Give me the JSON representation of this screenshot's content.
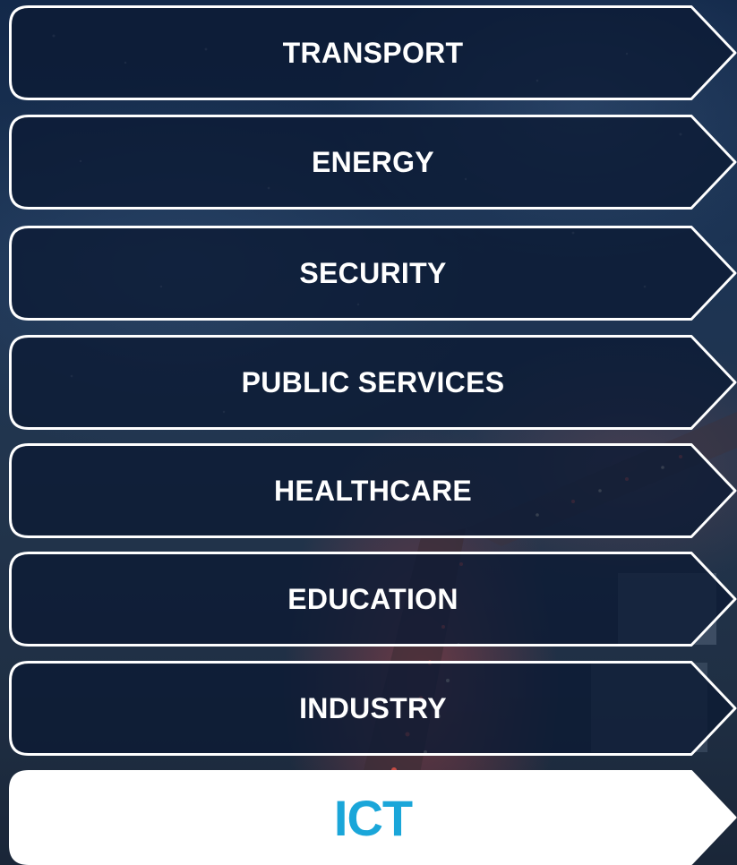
{
  "menu": {
    "items": [
      {
        "label": "TRANSPORT",
        "active": false
      },
      {
        "label": "ENERGY",
        "active": false
      },
      {
        "label": "SECURITY",
        "active": false
      },
      {
        "label": "PUBLIC SERVICES",
        "active": false
      },
      {
        "label": "HEALTHCARE",
        "active": false
      },
      {
        "label": "EDUCATION",
        "active": false
      },
      {
        "label": "INDUSTRY",
        "active": false
      },
      {
        "label": "ICT",
        "active": true
      }
    ]
  },
  "colors": {
    "item_fill": "#0c1a33",
    "item_border": "#ffffff",
    "active_fill": "#ffffff",
    "active_text": "#1aa6d9",
    "text": "#ffffff"
  },
  "background": {
    "scene": "night-city-highway-photo"
  }
}
